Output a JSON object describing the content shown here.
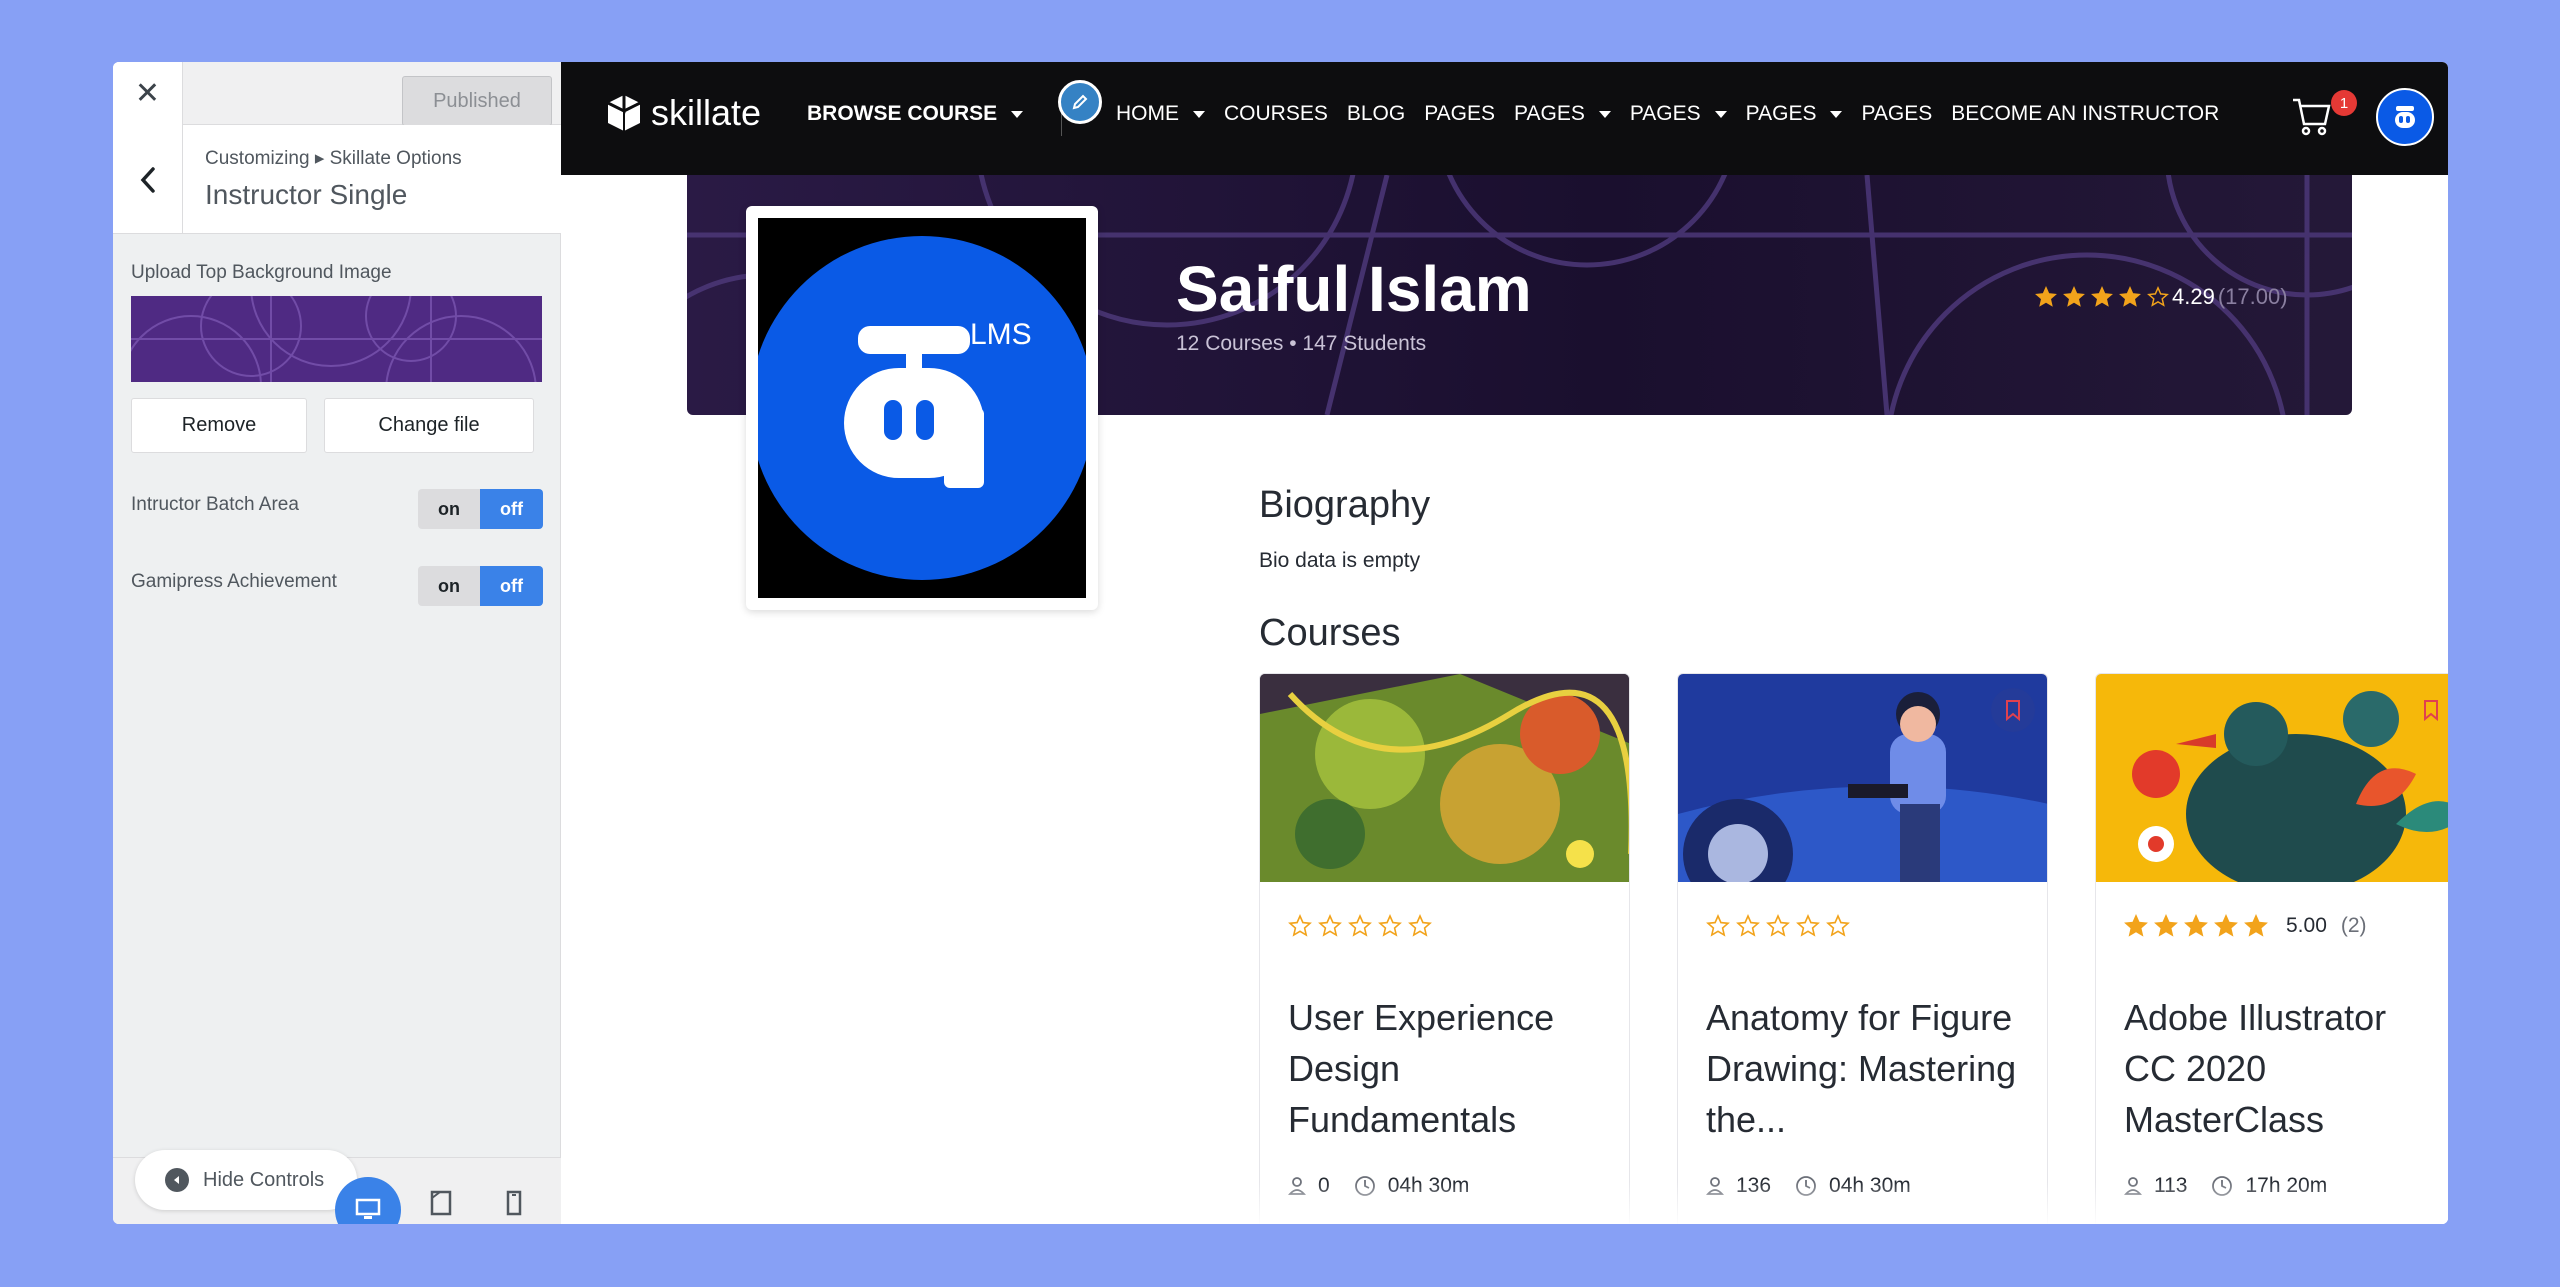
{
  "customizer": {
    "close_icon": "close-icon",
    "publish_label": "Published",
    "breadcrumb": "Customizing ▸ Skillate Options",
    "panel_title": "Instructor Single",
    "bg_image_label": "Upload Top Background Image",
    "remove_label": "Remove",
    "change_label": "Change file",
    "toggles": [
      {
        "label": "Intructor Batch Area",
        "on": "on",
        "off": "off",
        "state": "off"
      },
      {
        "label": "Gamipress Achievement",
        "on": "on",
        "off": "off",
        "state": "off"
      }
    ],
    "hide_controls_label": "Hide Controls",
    "devices": [
      "desktop",
      "tablet",
      "mobile"
    ],
    "accent": "#3a82e8"
  },
  "site": {
    "logo_text": "skillate",
    "browse_label": "BROWSE COURSE",
    "menu": [
      {
        "label": "HOME",
        "dropdown": true
      },
      {
        "label": "COURSES",
        "dropdown": false
      },
      {
        "label": "BLOG",
        "dropdown": false
      },
      {
        "label": "PAGES",
        "dropdown": false
      },
      {
        "label": "PAGES",
        "dropdown": true
      },
      {
        "label": "PAGES",
        "dropdown": true
      },
      {
        "label": "PAGES",
        "dropdown": true
      },
      {
        "label": "PAGES",
        "dropdown": false
      },
      {
        "label": "BECOME AN INSTRUCTOR",
        "dropdown": false
      }
    ],
    "cart_count": "1",
    "profile_logo_text": "LMS"
  },
  "instructor": {
    "name": "Saiful Islam",
    "stats": "12 Courses • 147 Students",
    "rating": "4.29",
    "rating_count": "(17.00)",
    "rating_value": 4.29,
    "biography_heading": "Biography",
    "bio": "Bio data is empty",
    "courses_heading": "Courses"
  },
  "courses": [
    {
      "title": "User Experience Design Fundamentals",
      "rating": 0,
      "rating_text": "",
      "rating_count": "",
      "students": "0",
      "duration": "04h 30m"
    },
    {
      "title": "Anatomy for Figure Drawing: Mastering the...",
      "rating": 0,
      "rating_text": "",
      "rating_count": "",
      "students": "136",
      "duration": "04h 30m"
    },
    {
      "title": "Adobe Illustrator CC 2020 MasterClass",
      "rating": 5,
      "rating_text": "5.00",
      "rating_count": "(2)",
      "students": "113",
      "duration": "17h 20m"
    }
  ],
  "colors": {
    "star": "#f2a31b",
    "nav_bg": "#0d0d0f",
    "banner": "#2a1a45",
    "brand_blue": "#0a5ae6"
  }
}
